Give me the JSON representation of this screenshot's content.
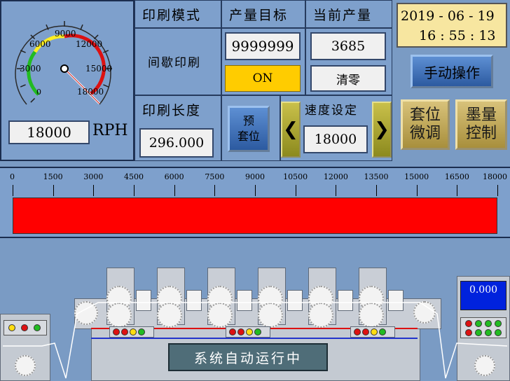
{
  "gauge": {
    "ticks": [
      "0",
      "3000",
      "6000",
      "9000",
      "12000",
      "15000",
      "18000"
    ],
    "speed_value": "18000",
    "unit": "RPH"
  },
  "print_mode": {
    "header": "印刷模式",
    "value": "间歇印刷"
  },
  "target_output": {
    "header": "产量目标",
    "value": "9999999",
    "status": "ON"
  },
  "current_output": {
    "header": "当前产量",
    "value": "3685",
    "reset_label": "清零"
  },
  "datetime": {
    "date": "2019 - 06 - 19",
    "time": "16 : 55 : 13"
  },
  "manual_button": "手动操作",
  "print_length": {
    "header": "印刷长度",
    "value": "296.000"
  },
  "preregister_button": "预\n套位",
  "speed_setting": {
    "header": "速度设定",
    "value": "18000",
    "decrease": "❮",
    "increase": "❯"
  },
  "register_fine_button": "套位\n微调",
  "ink_control_button": "墨量\n控制",
  "speed_bar": {
    "ticks": [
      "0",
      "1500",
      "3000",
      "4500",
      "6000",
      "7500",
      "9000",
      "10500",
      "12000",
      "13500",
      "15000",
      "16500",
      "18000"
    ],
    "fill_fraction": 1.0,
    "color": "#ff0000"
  },
  "machine": {
    "status_text": "系统自动运行中",
    "right_display": "0.000"
  },
  "colors": {
    "background": "#7a9bc4",
    "status_on": "#ffcc00",
    "date_bg": "#f7e6a0"
  }
}
